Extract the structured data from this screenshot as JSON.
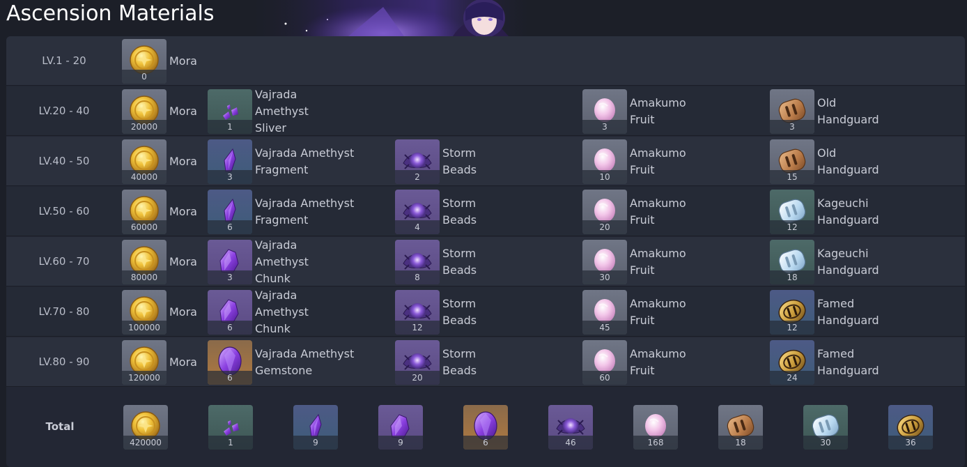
{
  "title": "Ascension Materials",
  "materials": {
    "mora": {
      "name": "Mora",
      "icon": "mora-coin-icon"
    },
    "sliver": {
      "name": "Vajrada Amethyst Sliver",
      "icon": "amethyst-sliver-icon"
    },
    "fragment": {
      "name": "Vajrada Amethyst Fragment",
      "icon": "amethyst-fragment-icon"
    },
    "chunk": {
      "name": "Vajrada Amethyst Chunk",
      "icon": "amethyst-chunk-icon"
    },
    "gemstone": {
      "name": "Vajrada Amethyst Gemstone",
      "icon": "amethyst-gemstone-icon"
    },
    "beads": {
      "name": "Storm Beads",
      "icon": "storm-beads-icon"
    },
    "fruit": {
      "name": "Amakumo Fruit",
      "icon": "amakumo-fruit-icon"
    },
    "old_guard": {
      "name": "Old Handguard",
      "icon": "old-handguard-icon"
    },
    "kageuchi_guard": {
      "name": "Kageuchi Handguard",
      "icon": "kageuchi-handguard-icon"
    },
    "famed_guard": {
      "name": "Famed Handguard",
      "icon": "famed-handguard-icon"
    }
  },
  "rows": [
    {
      "level": "LV.1 - 20",
      "mora": "0"
    },
    {
      "level": "LV.20 - 40",
      "mora": "20000",
      "gem": "1",
      "beads": "",
      "fruit": "3",
      "guard": "3"
    },
    {
      "level": "LV.40 - 50",
      "mora": "40000",
      "gem": "3",
      "beads": "2",
      "fruit": "10",
      "guard": "15"
    },
    {
      "level": "LV.50 - 60",
      "mora": "60000",
      "gem": "6",
      "beads": "4",
      "fruit": "20",
      "guard": "12"
    },
    {
      "level": "LV.60 - 70",
      "mora": "80000",
      "gem": "3",
      "beads": "8",
      "fruit": "30",
      "guard": "18"
    },
    {
      "level": "LV.70 - 80",
      "mora": "100000",
      "gem": "6",
      "beads": "12",
      "fruit": "45",
      "guard": "12"
    },
    {
      "level": "LV.80 - 90",
      "mora": "120000",
      "gem": "6",
      "beads": "20",
      "fruit": "60",
      "guard": "24"
    }
  ],
  "total": {
    "label": "Total",
    "counts": [
      "420000",
      "1",
      "9",
      "9",
      "6",
      "46",
      "168",
      "18",
      "30",
      "36"
    ]
  },
  "colors": {
    "page_bg": "#1c1f28",
    "panel_bg": "#232734",
    "row_odd": "#2b303d",
    "row_even": "#252a36",
    "text": "#c9ccd6",
    "title": "#ffffff"
  }
}
